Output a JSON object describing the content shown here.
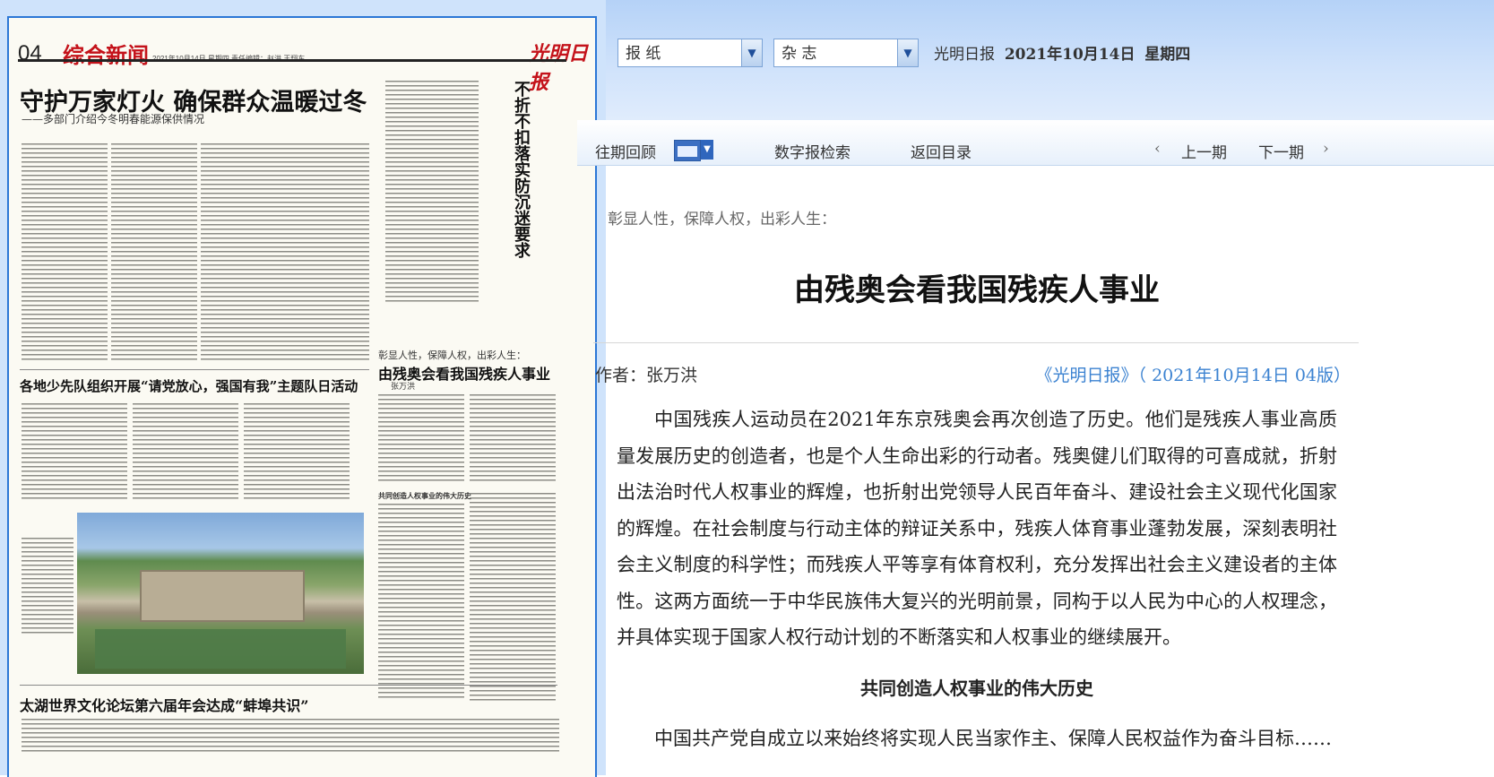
{
  "paper": {
    "page_number": "04",
    "section": "综合新闻",
    "masthead_meta": "2021年10月14日  星期四    责任编辑：赵洪   王翔东",
    "logo": "光明日报",
    "headline1": "守护万家灯火  确保群众温暖过冬",
    "headline1_sub": "——多部门介绍今冬明春能源保供情况",
    "headline2": "各地少先队组织开展“请党放心，强国有我”主题队日活动",
    "headline3": "太湖世界文化论坛第六届年会达成“蚌埠共识”",
    "vertical_headline": "不折不扣落实防沉迷要求",
    "article_lead": "彰显人性，保障人权，出彩人生：",
    "article_title": "由残奥会看我国残疾人事业",
    "article_byline": "张万洪",
    "article_subhead1": "共同创造人权事业的伟大历史"
  },
  "selectors": {
    "newspaper": "报  纸",
    "magazine": "杂  志"
  },
  "issue": {
    "paper_name": "光明日报",
    "date": "2021年10月14日",
    "weekday": "星期四"
  },
  "nav": {
    "archive": "往期回顾",
    "search": "数字报检索",
    "back_to_index": "返回目录",
    "prev_glyph": "‹",
    "prev": "上一期",
    "next": "下一期",
    "next_glyph": "›"
  },
  "article": {
    "lead": "彰显人性，保障人权，出彩人生：",
    "title": "由残奥会看我国残疾人事业",
    "author_label": "作者：张万洪",
    "source": "《光明日报》（ 2021年10月14日   04版）",
    "paragraph1": "中国残疾人运动员在2021年东京残奥会再次创造了历史。他们是残疾人事业高质量发展历史的创造者，也是个人生命出彩的行动者。残奥健儿们取得的可喜成就，折射出法治时代人权事业的辉煌，也折射出党领导人民百年奋斗、建设社会主义现代化国家的辉煌。在社会制度与行动主体的辩证关系中，残疾人体育事业蓬勃发展，深刻表明社会主义制度的科学性；而残疾人平等享有体育权利，充分发挥出社会主义建设者的主体性。这两方面统一于中华民族伟大复兴的光明前景，同构于以人民为中心的人权理念，并具体实现于国家人权行动计划的不断落实和人权事业的继续展开。",
    "subhead": "共同创造人权事业的伟大历史",
    "paragraph2": "中国共产党自成立以来始终将实现人民当家作主、保障人民权益作为奋斗目标……"
  }
}
